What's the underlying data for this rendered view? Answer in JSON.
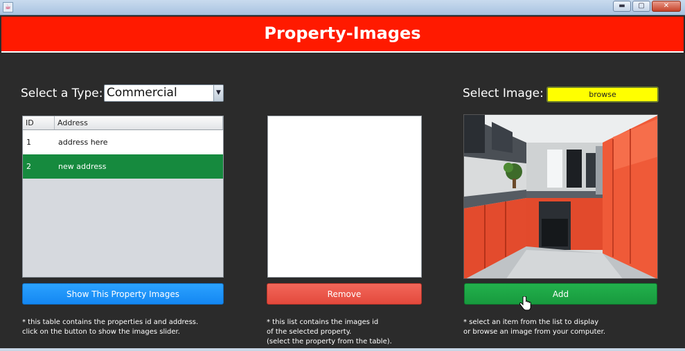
{
  "window": {
    "title": "",
    "minimize": "▬",
    "maximize": "▢",
    "close": "✕",
    "app_icon": "java-icon"
  },
  "header": {
    "title": "Property-Images"
  },
  "type_selector": {
    "label": "Select a Type:",
    "value": "Commercial",
    "arrow": "▼"
  },
  "image_selector": {
    "label": "Select Image:",
    "button": "browse"
  },
  "table": {
    "columns": [
      "ID",
      "Address"
    ],
    "rows": [
      {
        "id": "1",
        "address": "address here"
      },
      {
        "id": "2",
        "address": "new address"
      }
    ],
    "selected_row": 1
  },
  "buttons": {
    "show": "Show This Property Images",
    "remove": "Remove",
    "add": "Add"
  },
  "notes": {
    "table": [
      "* this table contains the properties id and address.",
      "click on the button to show the images slider."
    ],
    "list": [
      "* this list contains the images id",
      "of the selected property.",
      "(select the property from the table)."
    ],
    "image": [
      "* select an item from the list to display",
      "or browse an image from your computer."
    ]
  },
  "colors": {
    "header": "#ff1a00",
    "background": "#2b2b2b",
    "selected_row": "#168a3e",
    "show_button": "#1487f2",
    "remove_button": "#e3493c",
    "add_button": "#189a3e",
    "browse_button": "#ffff00"
  }
}
